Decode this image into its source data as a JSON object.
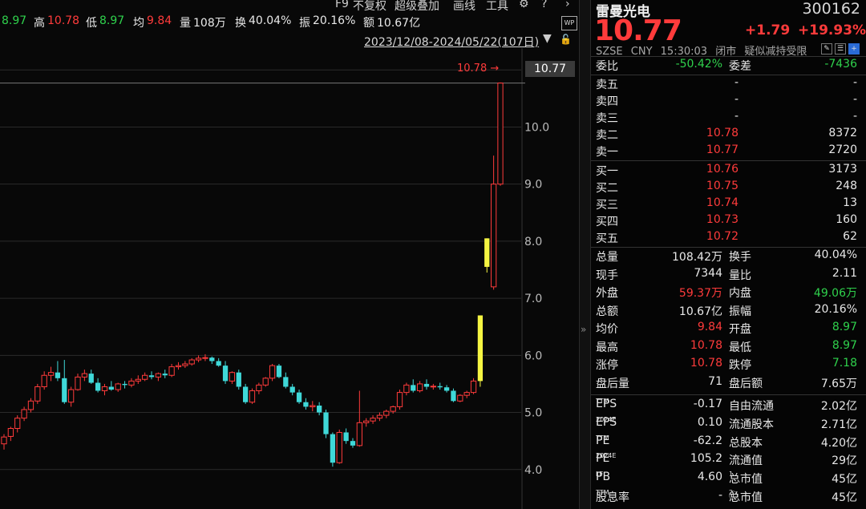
{
  "quote_bar": {
    "open_label": "开",
    "open_value": "8.97",
    "high_label": "高",
    "high_value": "10.78",
    "low_label": "低",
    "low_value": "8.97",
    "avg_label": "均",
    "avg_value": "9.84",
    "vol_label": "量",
    "vol_value": "108万",
    "turnover_label": "换",
    "turnover_value": "40.04%",
    "amplitude_label": "振",
    "amplitude_value": "20.16%",
    "amount_label": "额",
    "amount_value": "10.67亿"
  },
  "toolbar": {
    "f9": "F9",
    "adjust": "不复权",
    "overlay": "超级叠加",
    "draw": "画线",
    "tools": "工具",
    "gear_icon": "gear-icon",
    "help_icon": "help-icon",
    "next_icon": "chevron-right-icon",
    "wp": "WP"
  },
  "date_range": "2023/12/08-2024/05/22(107日)",
  "chart": {
    "high_marker": "10.78",
    "current_price_label": "10.77",
    "y_ticks": [
      "11.0",
      "10.0",
      "9.0",
      "8.0",
      "7.0",
      "6.0",
      "5.0",
      "4.0"
    ]
  },
  "chart_data": {
    "type": "candlestick",
    "ylim": [
      3.8,
      11.2
    ],
    "up_color": "#ff3b3b",
    "down_color": "#3fd8d8",
    "limit_up_color": "#f5f542",
    "candles": [
      {
        "o": 4.45,
        "h": 4.62,
        "l": 4.35,
        "c": 4.57
      },
      {
        "o": 4.58,
        "h": 4.75,
        "l": 4.5,
        "c": 4.72
      },
      {
        "o": 4.72,
        "h": 4.95,
        "l": 4.65,
        "c": 4.9
      },
      {
        "o": 4.9,
        "h": 5.1,
        "l": 4.85,
        "c": 5.05
      },
      {
        "o": 5.05,
        "h": 5.25,
        "l": 5.0,
        "c": 5.2
      },
      {
        "o": 5.2,
        "h": 5.5,
        "l": 5.15,
        "c": 5.45
      },
      {
        "o": 5.45,
        "h": 5.72,
        "l": 5.4,
        "c": 5.65
      },
      {
        "o": 5.65,
        "h": 5.8,
        "l": 5.55,
        "c": 5.7
      },
      {
        "o": 5.7,
        "h": 5.9,
        "l": 5.55,
        "c": 5.6
      },
      {
        "o": 5.6,
        "h": 5.92,
        "l": 5.15,
        "c": 5.18
      },
      {
        "o": 5.18,
        "h": 5.45,
        "l": 5.1,
        "c": 5.4
      },
      {
        "o": 5.4,
        "h": 5.68,
        "l": 5.38,
        "c": 5.62
      },
      {
        "o": 5.62,
        "h": 5.75,
        "l": 5.55,
        "c": 5.68
      },
      {
        "o": 5.68,
        "h": 5.75,
        "l": 5.5,
        "c": 5.52
      },
      {
        "o": 5.52,
        "h": 5.6,
        "l": 5.35,
        "c": 5.38
      },
      {
        "o": 5.38,
        "h": 5.5,
        "l": 5.3,
        "c": 5.45
      },
      {
        "o": 5.45,
        "h": 5.55,
        "l": 5.38,
        "c": 5.4
      },
      {
        "o": 5.4,
        "h": 5.52,
        "l": 5.36,
        "c": 5.5
      },
      {
        "o": 5.5,
        "h": 5.55,
        "l": 5.42,
        "c": 5.48
      },
      {
        "o": 5.48,
        "h": 5.6,
        "l": 5.44,
        "c": 5.55
      },
      {
        "o": 5.55,
        "h": 5.65,
        "l": 5.5,
        "c": 5.58
      },
      {
        "o": 5.58,
        "h": 5.7,
        "l": 5.55,
        "c": 5.65
      },
      {
        "o": 5.65,
        "h": 5.72,
        "l": 5.58,
        "c": 5.62
      },
      {
        "o": 5.62,
        "h": 5.7,
        "l": 5.55,
        "c": 5.68
      },
      {
        "o": 5.68,
        "h": 5.75,
        "l": 5.6,
        "c": 5.65
      },
      {
        "o": 5.65,
        "h": 5.85,
        "l": 5.62,
        "c": 5.8
      },
      {
        "o": 5.8,
        "h": 5.88,
        "l": 5.75,
        "c": 5.82
      },
      {
        "o": 5.82,
        "h": 5.9,
        "l": 5.78,
        "c": 5.85
      },
      {
        "o": 5.85,
        "h": 5.95,
        "l": 5.82,
        "c": 5.92
      },
      {
        "o": 5.92,
        "h": 6.0,
        "l": 5.88,
        "c": 5.95
      },
      {
        "o": 5.95,
        "h": 6.02,
        "l": 5.9,
        "c": 5.96
      },
      {
        "o": 5.96,
        "h": 5.98,
        "l": 5.85,
        "c": 5.9
      },
      {
        "o": 5.9,
        "h": 5.95,
        "l": 5.8,
        "c": 5.82
      },
      {
        "o": 5.82,
        "h": 5.9,
        "l": 5.5,
        "c": 5.55
      },
      {
        "o": 5.55,
        "h": 5.72,
        "l": 5.5,
        "c": 5.7
      },
      {
        "o": 5.7,
        "h": 5.75,
        "l": 5.4,
        "c": 5.45
      },
      {
        "o": 5.45,
        "h": 5.5,
        "l": 5.15,
        "c": 5.18
      },
      {
        "o": 5.18,
        "h": 5.42,
        "l": 5.15,
        "c": 5.38
      },
      {
        "o": 5.38,
        "h": 5.52,
        "l": 5.32,
        "c": 5.48
      },
      {
        "o": 5.48,
        "h": 5.62,
        "l": 5.45,
        "c": 5.6
      },
      {
        "o": 5.6,
        "h": 5.85,
        "l": 5.55,
        "c": 5.82
      },
      {
        "o": 5.82,
        "h": 5.85,
        "l": 5.6,
        "c": 5.62
      },
      {
        "o": 5.62,
        "h": 5.7,
        "l": 5.42,
        "c": 5.45
      },
      {
        "o": 5.45,
        "h": 5.5,
        "l": 5.3,
        "c": 5.35
      },
      {
        "o": 5.35,
        "h": 5.4,
        "l": 5.15,
        "c": 5.18
      },
      {
        "o": 5.18,
        "h": 5.25,
        "l": 5.05,
        "c": 5.1
      },
      {
        "o": 5.1,
        "h": 5.2,
        "l": 5.02,
        "c": 5.12
      },
      {
        "o": 5.12,
        "h": 5.18,
        "l": 4.95,
        "c": 5.0
      },
      {
        "o": 5.0,
        "h": 5.05,
        "l": 4.55,
        "c": 4.62
      },
      {
        "o": 4.62,
        "h": 4.65,
        "l": 4.05,
        "c": 4.12
      },
      {
        "o": 4.12,
        "h": 4.7,
        "l": 4.1,
        "c": 4.65
      },
      {
        "o": 4.65,
        "h": 4.72,
        "l": 4.45,
        "c": 4.5
      },
      {
        "o": 4.5,
        "h": 4.55,
        "l": 4.38,
        "c": 4.42
      },
      {
        "o": 4.42,
        "h": 5.38,
        "l": 4.4,
        "c": 4.82
      },
      {
        "o": 4.82,
        "h": 4.9,
        "l": 4.75,
        "c": 4.85
      },
      {
        "o": 4.85,
        "h": 4.95,
        "l": 4.8,
        "c": 4.9
      },
      {
        "o": 4.9,
        "h": 5.0,
        "l": 4.85,
        "c": 4.95
      },
      {
        "o": 4.95,
        "h": 5.05,
        "l": 4.9,
        "c": 5.02
      },
      {
        "o": 5.02,
        "h": 5.12,
        "l": 4.98,
        "c": 5.1
      },
      {
        "o": 5.1,
        "h": 5.4,
        "l": 5.05,
        "c": 5.35
      },
      {
        "o": 5.35,
        "h": 5.52,
        "l": 5.3,
        "c": 5.48
      },
      {
        "o": 5.48,
        "h": 5.58,
        "l": 5.35,
        "c": 5.38
      },
      {
        "o": 5.38,
        "h": 5.55,
        "l": 5.35,
        "c": 5.5
      },
      {
        "o": 5.5,
        "h": 5.58,
        "l": 5.4,
        "c": 5.45
      },
      {
        "o": 5.45,
        "h": 5.5,
        "l": 5.4,
        "c": 5.46
      },
      {
        "o": 5.46,
        "h": 5.52,
        "l": 5.4,
        "c": 5.44
      },
      {
        "o": 5.44,
        "h": 5.48,
        "l": 5.35,
        "c": 5.38
      },
      {
        "o": 5.38,
        "h": 5.42,
        "l": 5.18,
        "c": 5.2
      },
      {
        "o": 5.2,
        "h": 5.32,
        "l": 5.18,
        "c": 5.3
      },
      {
        "o": 5.3,
        "h": 5.38,
        "l": 5.25,
        "c": 5.35
      },
      {
        "o": 5.35,
        "h": 5.6,
        "l": 5.32,
        "c": 5.55
      },
      {
        "o": 5.55,
        "h": 6.7,
        "l": 5.45,
        "c": 6.7,
        "limit": true
      },
      {
        "o": 7.55,
        "h": 8.05,
        "l": 7.45,
        "c": 8.05,
        "limit": true
      },
      {
        "o": 7.2,
        "h": 9.5,
        "l": 7.15,
        "c": 9.0
      },
      {
        "o": 9.0,
        "h": 10.78,
        "l": 8.97,
        "c": 10.77
      }
    ]
  },
  "panel": {
    "name": "雷曼光电",
    "code": "300162",
    "price": "10.77",
    "change": "+1.79",
    "change_pct": "+19.93%",
    "exchange": "SZSE",
    "currency": "CNY",
    "time": "15:30:03",
    "status": "闭市",
    "tag": "疑似减持受限",
    "weibi_label": "委比",
    "weibi_value": "-50.42%",
    "weicha_label": "委差",
    "weicha_value": "-7436",
    "asks": [
      {
        "label": "卖五",
        "price": "-",
        "vol": "-"
      },
      {
        "label": "卖四",
        "price": "-",
        "vol": "-"
      },
      {
        "label": "卖三",
        "price": "-",
        "vol": "-"
      },
      {
        "label": "卖二",
        "price": "10.78",
        "vol": "8372"
      },
      {
        "label": "卖一",
        "price": "10.77",
        "vol": "2720"
      }
    ],
    "bids": [
      {
        "label": "买一",
        "price": "10.76",
        "vol": "3173"
      },
      {
        "label": "买二",
        "price": "10.75",
        "vol": "248"
      },
      {
        "label": "买三",
        "price": "10.74",
        "vol": "13"
      },
      {
        "label": "买四",
        "price": "10.73",
        "vol": "160"
      },
      {
        "label": "买五",
        "price": "10.72",
        "vol": "62"
      }
    ],
    "stats": [
      {
        "l1": "总量",
        "v1": "108.42万",
        "c1": "white",
        "l2": "换手",
        "v2": "40.04%",
        "c2": "white"
      },
      {
        "l1": "现手",
        "v1": "7344",
        "c1": "white",
        "l2": "量比",
        "v2": "2.11",
        "c2": "white"
      },
      {
        "l1": "外盘",
        "v1": "59.37万",
        "c1": "red",
        "l2": "内盘",
        "v2": "49.06万",
        "c2": "green"
      },
      {
        "l1": "总额",
        "v1": "10.67亿",
        "c1": "white",
        "l2": "振幅",
        "v2": "20.16%",
        "c2": "white"
      },
      {
        "l1": "均价",
        "v1": "9.84",
        "c1": "red",
        "l2": "开盘",
        "v2": "8.97",
        "c2": "green"
      },
      {
        "l1": "最高",
        "v1": "10.78",
        "c1": "red",
        "l2": "最低",
        "v2": "8.97",
        "c2": "green"
      },
      {
        "l1": "涨停",
        "v1": "10.78",
        "c1": "red",
        "l2": "跌停",
        "v2": "7.18",
        "c2": "green"
      },
      {
        "l1": "盘后量",
        "v1": "71",
        "c1": "white",
        "l2": "盘后额",
        "v2": "7.65万",
        "c2": "white"
      }
    ],
    "fund": [
      {
        "l1": "EPS",
        "s1": "TTM",
        "v1": "-0.17",
        "l2": "自由流通",
        "v2": "2.02亿"
      },
      {
        "l1": "EPS",
        "s1": "2024E",
        "v1": "0.10",
        "l2": "流通股本",
        "v2": "2.71亿"
      },
      {
        "l1": "PE",
        "s1": "TTM",
        "v1": "-62.2",
        "l2": "总股本",
        "v2": "4.20亿"
      },
      {
        "l1": "PE",
        "s1": "2024E",
        "v1": "105.2",
        "l2": "流通值",
        "v2": "29亿"
      },
      {
        "l1": "PB",
        "s1": "LF",
        "v1": "4.60",
        "l2": "总市值",
        "s2": "1",
        "v2": "45亿"
      },
      {
        "l1": "股息率",
        "s1": "TTM",
        "v1": "-",
        "l2": "总市值",
        "s2": "2",
        "v2": "45亿"
      }
    ]
  }
}
